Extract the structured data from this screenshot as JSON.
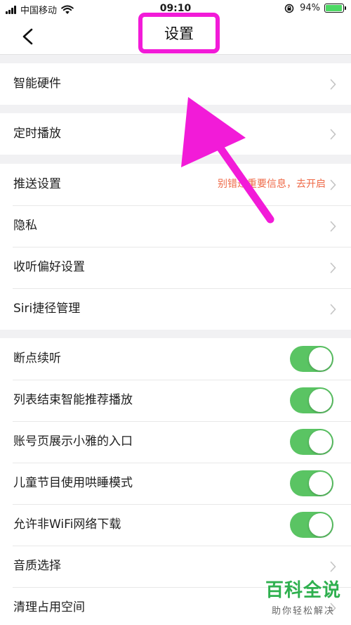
{
  "status_bar": {
    "carrier": "中国移动",
    "time": "09:10",
    "battery": "94%",
    "battery_level": 0.94
  },
  "nav": {
    "title": "设置",
    "back_icon": "chevron-left-icon"
  },
  "groups": [
    {
      "items": [
        {
          "label": "智能硬件",
          "control": "chevron"
        }
      ]
    },
    {
      "items": [
        {
          "label": "定时播放",
          "control": "chevron"
        }
      ]
    },
    {
      "items": [
        {
          "label": "推送设置",
          "hint": "别错过重要信息，去开启",
          "control": "chevron"
        },
        {
          "label": "隐私",
          "control": "chevron"
        },
        {
          "label": "收听偏好设置",
          "control": "chevron"
        },
        {
          "label": "Siri捷径管理",
          "control": "chevron"
        }
      ]
    },
    {
      "items": [
        {
          "label": "断点续听",
          "control": "toggle",
          "on": true
        },
        {
          "label": "列表结束智能推荐播放",
          "control": "toggle",
          "on": true
        },
        {
          "label": "账号页展示小雅的入口",
          "control": "toggle",
          "on": true
        },
        {
          "label": "儿童节目使用哄睡模式",
          "control": "toggle",
          "on": true
        },
        {
          "label": "允许非WiFi网络下载",
          "control": "toggle",
          "on": true
        },
        {
          "label": "音质选择",
          "control": "chevron"
        },
        {
          "label": "清理占用空间",
          "control": "chevron"
        }
      ]
    }
  ],
  "watermark": {
    "main": "百科全说",
    "sub": "助你轻松解决"
  },
  "colors": {
    "toggle_on": "#5ac463",
    "hint": "#ef6a48",
    "highlight": "#f21bd8",
    "watermark": "#2fb04f"
  }
}
